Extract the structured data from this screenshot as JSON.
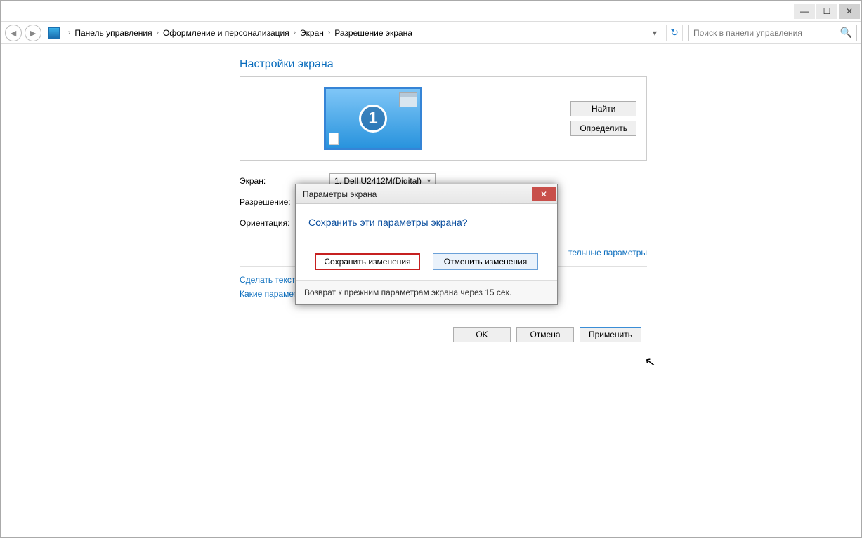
{
  "titlebar": {
    "minimize": "—",
    "maximize": "☐",
    "close": "✕"
  },
  "nav": {
    "back": "◄",
    "forward": "►",
    "crumbs": [
      "Панель управления",
      "Оформление и персонализация",
      "Экран",
      "Разрешение экрана"
    ],
    "chevron": "›",
    "addr_drop": "▾",
    "refresh": "↻"
  },
  "search": {
    "placeholder": "Поиск в панели управления",
    "icon": "🔍"
  },
  "main": {
    "section_title": "Настройки экрана",
    "monitor_number": "1",
    "find_btn": "Найти",
    "identify_btn": "Определить",
    "labels": {
      "screen": "Экран:",
      "resolution": "Разрешение:",
      "orientation": "Ориентация:"
    },
    "screen_value": "1. Dell U2412M(Digital)",
    "adv_link_partial": "тельные параметры",
    "link1_partial": "Сделать текст и",
    "link2_partial": "Какие параметр"
  },
  "buttons": {
    "ok": "OK",
    "cancel": "Отмена",
    "apply": "Применить"
  },
  "modal": {
    "title": "Параметры экрана",
    "close": "✕",
    "question": "Сохранить эти параметры экрана?",
    "save": "Сохранить изменения",
    "revert": "Отменить изменения",
    "footer": "Возврат к прежним параметрам экрана через 15 сек."
  }
}
